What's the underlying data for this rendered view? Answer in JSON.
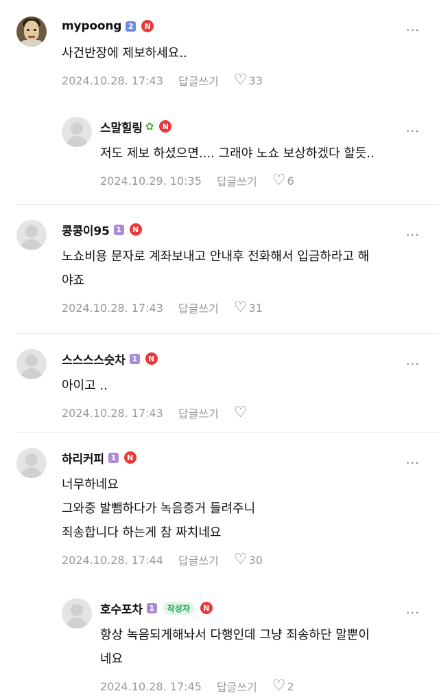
{
  "comments": [
    {
      "username": "mypoong",
      "level": "2",
      "text": "사건반장에 제보하세요..",
      "date": "2024.10.28. 17:43",
      "reply_label": "답글쓰기",
      "likes": "33"
    },
    {
      "username": "스말힐링",
      "text": "저도 제보 하셨으면.... 그래야 노쇼 보상하겠다 할듯..",
      "date": "2024.10.29. 10:35",
      "reply_label": "답글쓰기",
      "likes": "6"
    },
    {
      "username": "콩콩이95",
      "level": "1",
      "text_lines": [
        "노쇼비용 문자로 계좌보내고 안내후 전화해서 입금하라고 해",
        "야죠"
      ],
      "date": "2024.10.28. 17:43",
      "reply_label": "답글쓰기",
      "likes": "31"
    },
    {
      "username": "스스스스슷차",
      "level": "1",
      "text": "아이고 ..",
      "date": "2024.10.28. 17:43",
      "reply_label": "답글쓰기",
      "likes": ""
    },
    {
      "username": "하리커피",
      "level": "1",
      "text_lines": [
        "너무하네요",
        "그와중 발뺌하다가 녹음증거 들려주니",
        "죄송합니다 하는게 참 짜치네요"
      ],
      "date": "2024.10.28. 17:44",
      "reply_label": "답글쓰기",
      "likes": "30"
    },
    {
      "username": "호수포차",
      "level": "1",
      "author_tag": "작성자",
      "text_lines": [
        "항상 녹음되게해놔서 다행인데 그냥 죄송하단 말뿐이",
        "네요"
      ],
      "date": "2024.10.28. 17:45",
      "reply_label": "답글쓰기",
      "likes": "2"
    }
  ],
  "badge_letter": "N",
  "more_icon": "···",
  "heart_icon": "♡",
  "colors": {
    "level2": "#6d8be0",
    "level1": "#a88bd6",
    "n_badge": "#e83a3a",
    "author_tag_bg": "#e3f6ea",
    "author_tag_text": "#1ea752"
  }
}
